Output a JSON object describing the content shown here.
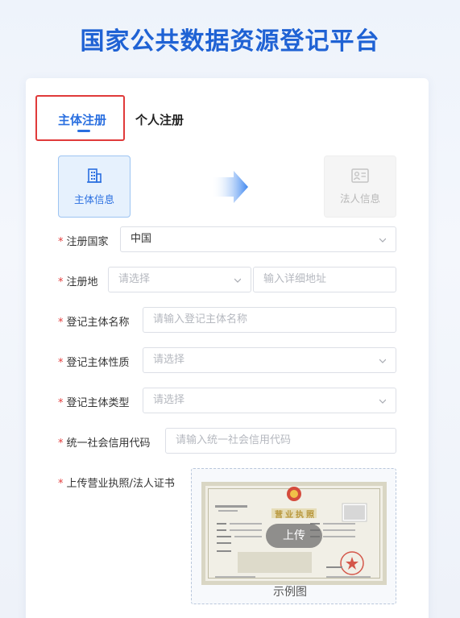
{
  "page": {
    "title": "国家公共数据资源登记平台"
  },
  "tabs": [
    {
      "label": "主体注册",
      "active": true
    },
    {
      "label": "个人注册",
      "active": false
    }
  ],
  "steps": [
    {
      "label": "主体信息",
      "icon": "building-icon",
      "active": true
    },
    {
      "label": "法人信息",
      "icon": "id-card-icon",
      "active": false
    }
  ],
  "form": {
    "required_mark": "*",
    "country": {
      "label": "注册国家",
      "value": "中国"
    },
    "location": {
      "label": "注册地",
      "select_placeholder": "请选择",
      "address_placeholder": "输入详细地址"
    },
    "entity_name": {
      "label": "登记主体名称",
      "placeholder": "请输入登记主体名称"
    },
    "entity_nature": {
      "label": "登记主体性质",
      "placeholder": "请选择"
    },
    "entity_type": {
      "label": "登记主体类型",
      "placeholder": "请选择"
    },
    "credit_code": {
      "label": "统一社会信用代码",
      "placeholder": "请输入统一社会信用代码"
    },
    "upload": {
      "label": "上传营业执照/法人证书",
      "button": "上传",
      "sample_caption": "示例图",
      "license_title": "营业执照"
    }
  },
  "colors": {
    "accent": "#2a6fe0",
    "highlight_border": "#e03a3a",
    "required": "#e23c3c"
  }
}
